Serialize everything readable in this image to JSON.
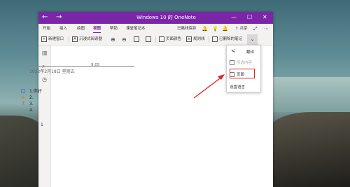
{
  "window": {
    "title": "Windows 10 的 OneNote",
    "nav_back": "←",
    "nav_forward": "→",
    "minimize": "—",
    "maximize": "☐",
    "close": "✕",
    "title_color": "#7a26a7"
  },
  "menu": {
    "tabs": [
      "开始",
      "插入",
      "绘图",
      "视图",
      "帮助",
      "课堂笔记本"
    ],
    "active_tab": "视图",
    "saved_status": "已离线保存",
    "share_label": "共享",
    "more": "⋯"
  },
  "ribbon": {
    "new_window": "新建窗口",
    "immersive_reader": "沉浸式阅读器",
    "page_color": "页面颜色",
    "rule_lines": "规则线",
    "deleted_notes": "已删除的笔记"
  },
  "page": {
    "date": "2022年2月18日 星期五",
    "time": "9:05",
    "items": [
      {
        "text": "1.你好",
        "marker": "checkbox"
      },
      {
        "text": "2.",
        "marker": "star"
      },
      {
        "text": "3.",
        "marker": "question"
      },
      {
        "text": "4.",
        "marker": "none"
      }
    ],
    "stray": "1"
  },
  "panel": {
    "back": "<",
    "title": "翻译",
    "items": [
      {
        "label": "所选内容",
        "disabled": true
      },
      {
        "label": "页面",
        "disabled": false
      },
      {
        "label": "设置语言",
        "disabled": false
      }
    ]
  },
  "annotation": {
    "arrow_color": "#e02424"
  }
}
